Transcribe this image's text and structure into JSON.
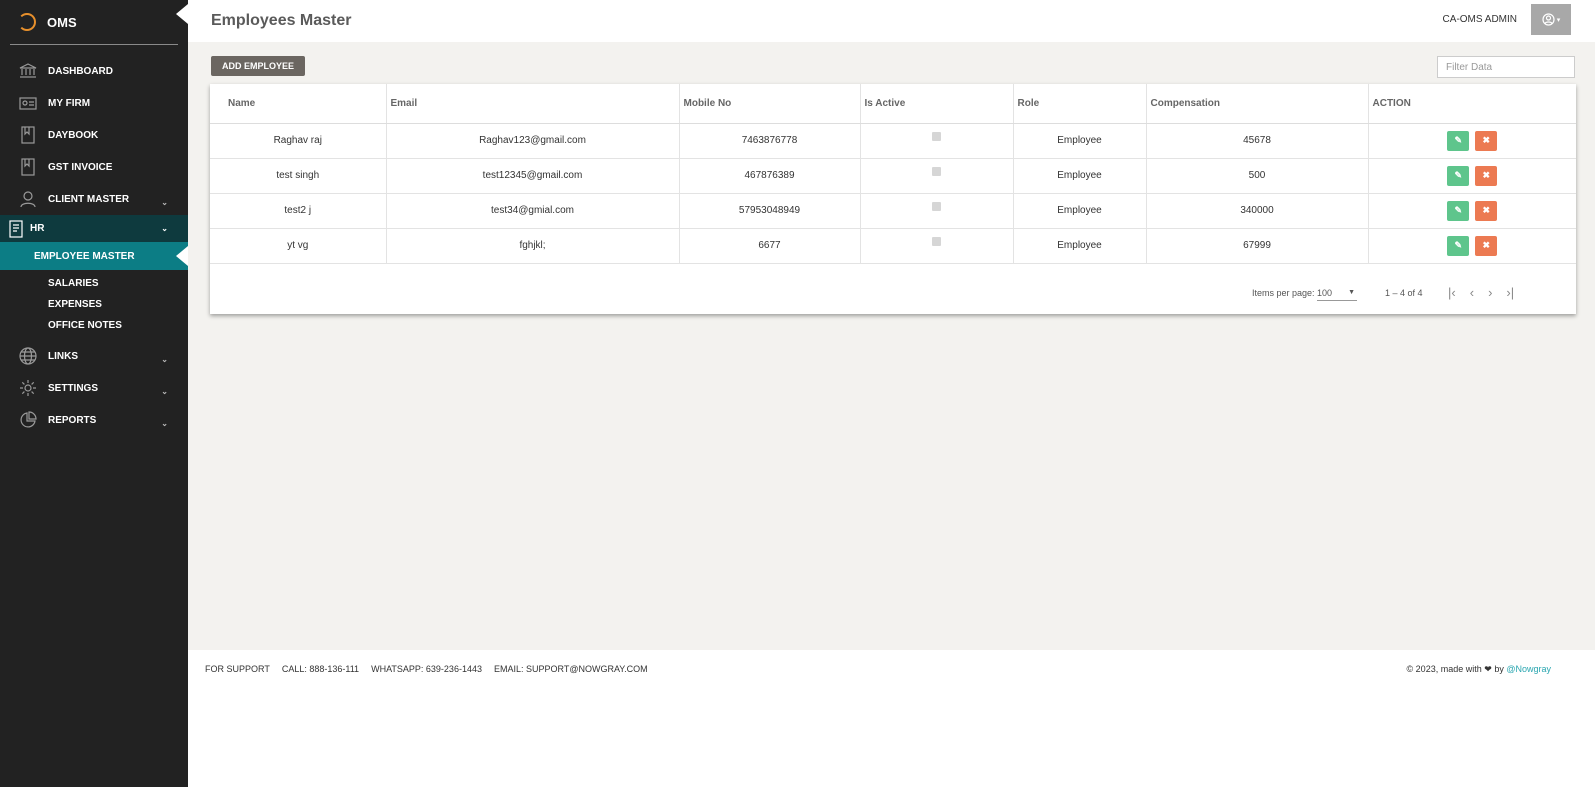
{
  "brand": {
    "name": "OMS"
  },
  "sidebar": {
    "items": [
      {
        "label": "DASHBOARD",
        "icon": "bank-icon"
      },
      {
        "label": "MY FIRM",
        "icon": "id-card-icon"
      },
      {
        "label": "DAYBOOK",
        "icon": "book-icon"
      },
      {
        "label": "GST INVOICE",
        "icon": "book-icon"
      },
      {
        "label": "CLIENT MASTER",
        "icon": "user-icon"
      }
    ],
    "hr_label": "HR",
    "hr_sub": [
      {
        "label": "EMPLOYEE MASTER"
      },
      {
        "label": "SALARIES"
      },
      {
        "label": "EXPENSES"
      },
      {
        "label": "OFFICE NOTES"
      }
    ],
    "bottom_items": [
      {
        "label": "LINKS",
        "icon": "globe-icon"
      },
      {
        "label": "SETTINGS",
        "icon": "gear-icon"
      },
      {
        "label": "REPORTS",
        "icon": "pie-chart-icon"
      }
    ]
  },
  "header": {
    "title": "Employees Master",
    "user": "CA-OMS ADMIN"
  },
  "toolbar": {
    "add_label": "ADD EMPLOYEE",
    "filter_placeholder": "Filter Data"
  },
  "table": {
    "headers": [
      "Name",
      "Email",
      "Mobile No",
      "Is Active",
      "Role",
      "Compensation",
      "ACTION"
    ],
    "rows": [
      {
        "name": "Raghav raj",
        "email": "Raghav123@gmail.com",
        "mobile": "7463876778",
        "role": "Employee",
        "comp": "45678"
      },
      {
        "name": "test singh",
        "email": "test12345@gmail.com",
        "mobile": "467876389",
        "role": "Employee",
        "comp": "500"
      },
      {
        "name": "test2 j",
        "email": "test34@gmial.com",
        "mobile": "57953048949",
        "role": "Employee",
        "comp": "340000"
      },
      {
        "name": "yt vg",
        "email": "fghjkl;",
        "mobile": "6677",
        "role": "Employee",
        "comp": "67999"
      }
    ]
  },
  "pagination": {
    "items_per_page_label": "Items per page:",
    "items_per_page": "100",
    "range": "1 – 4 of 4"
  },
  "footer": {
    "support": "FOR SUPPORT",
    "call": "CALL: 888-136-111",
    "whatsapp": "WHATSAPP: 639-236-1443",
    "email": "EMAIL: SUPPORT@NOWGRAY.COM",
    "copyright": "© 2023, made with",
    "by": "by",
    "link": "@Nowgray"
  }
}
